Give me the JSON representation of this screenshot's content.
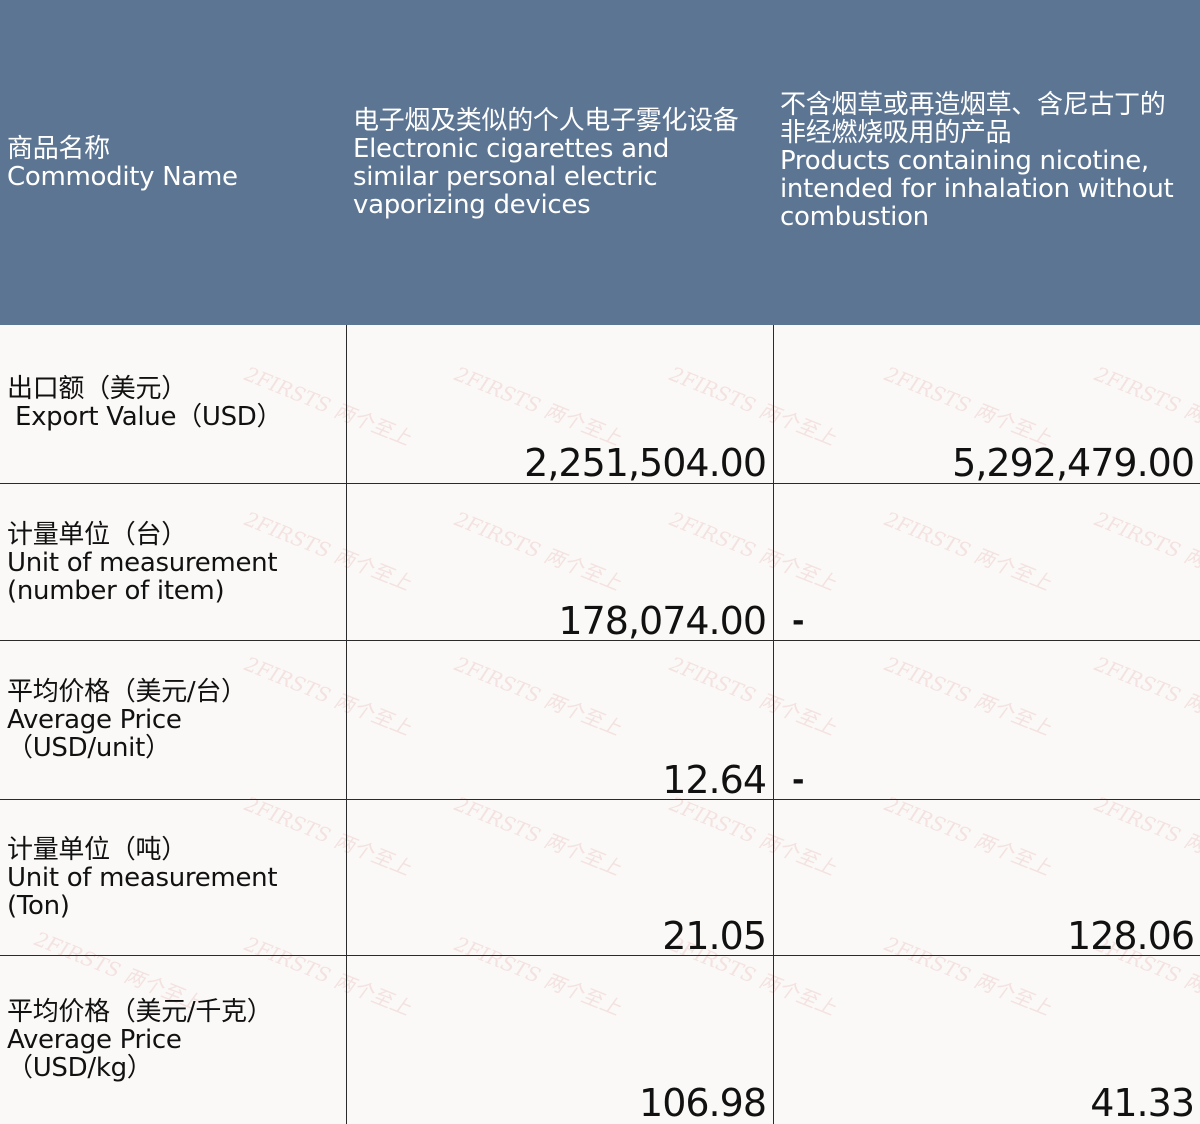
{
  "header": {
    "col0": {
      "zh": "商品名称",
      "en": "Commodity Name"
    },
    "col1": {
      "zh": "电子烟及类似的个人电子雾化设备",
      "en_lines": [
        "Electronic cigarettes and",
        "similar personal electric",
        "vaporizing devices"
      ]
    },
    "col2": {
      "zh_lines": [
        "不含烟草或再造烟草、含尼古丁的",
        "非经燃烧吸用的产品"
      ],
      "en_lines": [
        "Products containing nicotine,",
        "intended for inhalation without",
        "combustion"
      ]
    }
  },
  "rows": [
    {
      "label_lines": [
        "出口额（美元）",
        " Export Value（USD）"
      ],
      "col1": "2,251,504.00",
      "col2": "5,292,479.00"
    },
    {
      "label_lines": [
        "计量单位（台）",
        "Unit of measurement",
        "(number of item)"
      ],
      "col1": "178,074.00",
      "col2": "-"
    },
    {
      "label_lines": [
        "平均价格（美元/台）",
        "Average Price",
        "（USD/unit）"
      ],
      "col1": "12.64",
      "col2": "-"
    },
    {
      "label_lines": [
        "计量单位（吨）",
        "Unit of measurement",
        "(Ton)"
      ],
      "col1": "21.05",
      "col2": "128.06"
    },
    {
      "label_lines": [
        "平均价格（美元/千克）",
        "Average Price",
        "（USD/kg）"
      ],
      "col1": "106.98",
      "col2": "41.33"
    }
  ],
  "watermark": "2FIRSTS 两个至上"
}
